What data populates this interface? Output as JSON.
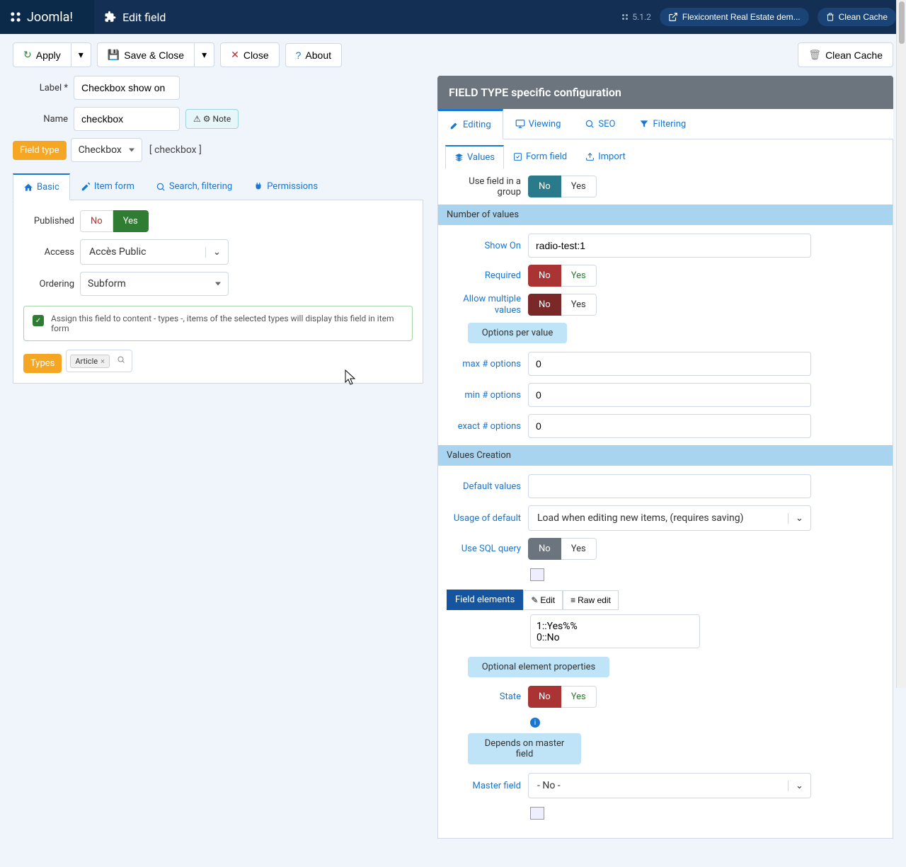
{
  "header": {
    "brand": "Joomla!",
    "title": "Edit field",
    "version": "5.1.2",
    "site_link": "Flexicontent Real Estate dem...",
    "clean_cache": "Clean Cache"
  },
  "toolbar": {
    "apply": "Apply",
    "save_close": "Save & Close",
    "close": "Close",
    "about": "About",
    "clean_cache": "Clean Cache"
  },
  "left": {
    "label_lbl": "Label *",
    "label_val": "Checkbox show on",
    "name_lbl": "Name",
    "name_val": "checkbox",
    "note": "Note",
    "fieldtype_lbl": "Field type",
    "fieldtype_val": "Checkbox",
    "fieldtype_code": "[ checkbox ]",
    "tabs": {
      "basic": "Basic",
      "item_form": "Item form",
      "search": "Search, filtering",
      "permissions": "Permissions"
    },
    "published_lbl": "Published",
    "no": "No",
    "yes": "Yes",
    "access_lbl": "Access",
    "access_val": "Accès Public",
    "ordering_lbl": "Ordering",
    "ordering_val": "Subform",
    "info": "Assign this field to content - types -, items of the selected types will display this field in item form",
    "types_lbl": "Types",
    "types_chip": "Article"
  },
  "right": {
    "head": "FIELD TYPE specific configuration",
    "tabs": {
      "editing": "Editing",
      "viewing": "Viewing",
      "seo": "SEO",
      "filtering": "Filtering"
    },
    "subtabs": {
      "values": "Values",
      "form_field": "Form field",
      "import": "Import"
    },
    "use_group_lbl": "Use field in a group",
    "no": "No",
    "yes": "Yes",
    "sec_num_values": "Number of values",
    "show_on_lbl": "Show On",
    "show_on_val": "radio-test:1",
    "required_lbl": "Required",
    "allow_multi_lbl": "Allow multiple values",
    "options_per_value": "Options per value",
    "max_opts_lbl": "max # options",
    "max_opts_val": "0",
    "min_opts_lbl": "min # options",
    "min_opts_val": "0",
    "exact_opts_lbl": "exact # options",
    "exact_opts_val": "0",
    "sec_values_creation": "Values Creation",
    "default_lbl": "Default values",
    "default_val": "",
    "usage_lbl": "Usage of default",
    "usage_val": "Load when editing new items, (requires saving)",
    "sql_lbl": "Use SQL query",
    "field_elements": "Field elements",
    "edit": "Edit",
    "raw_edit": "Raw edit",
    "elements_text": "1::Yes%%\n0::No",
    "opt_elem_props": "Optional element properties",
    "state_lbl": "State",
    "depends_master": "Depends on master field",
    "master_lbl": "Master field",
    "master_val": "- No -"
  }
}
